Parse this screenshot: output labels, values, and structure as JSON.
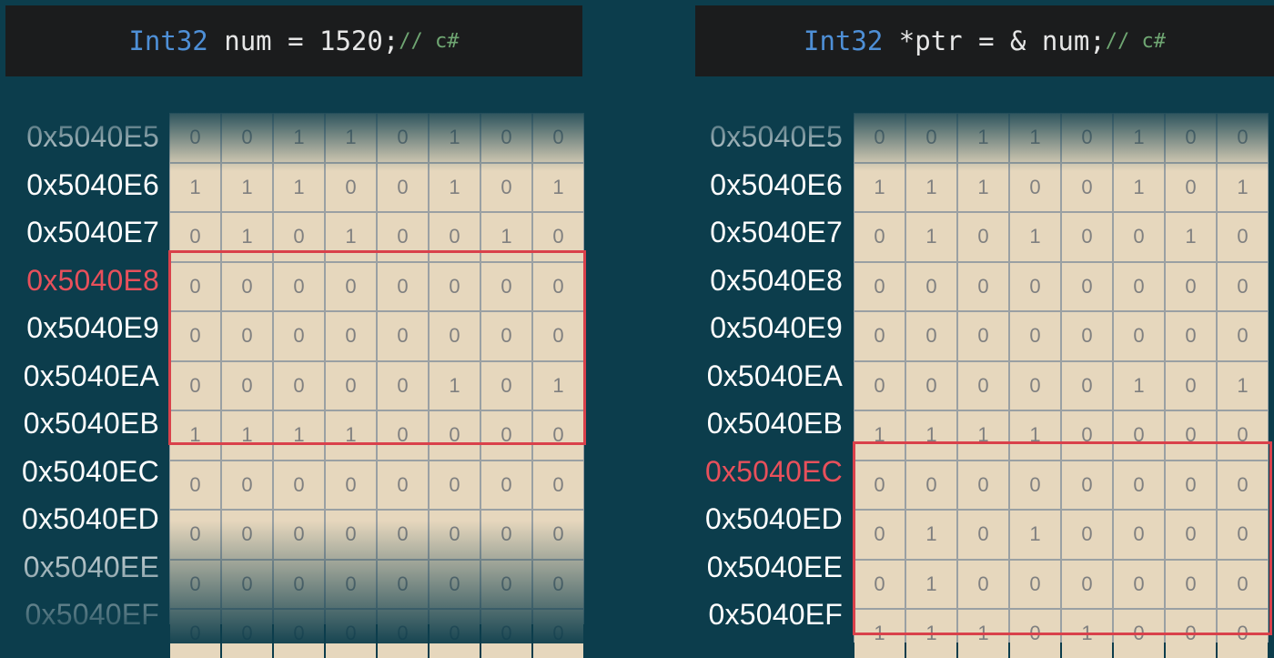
{
  "left": {
    "code": {
      "type": "Int32",
      "rest": " num = 1520;",
      "comment": "// c#"
    },
    "addresses": [
      "0x5040E5",
      "0x5040E6",
      "0x5040E7",
      "0x5040E8",
      "0x5040E9",
      "0x5040EA",
      "0x5040EB",
      "0x5040EC",
      "0x5040ED",
      "0x5040EE",
      "0x5040EF"
    ],
    "highlight_address": "0x5040E8",
    "rows": [
      [
        "0",
        "0",
        "1",
        "1",
        "0",
        "1",
        "0",
        "0"
      ],
      [
        "1",
        "1",
        "1",
        "0",
        "0",
        "1",
        "0",
        "1"
      ],
      [
        "0",
        "1",
        "0",
        "1",
        "0",
        "0",
        "1",
        "0"
      ],
      [
        "0",
        "0",
        "0",
        "0",
        "0",
        "0",
        "0",
        "0"
      ],
      [
        "0",
        "0",
        "0",
        "0",
        "0",
        "0",
        "0",
        "0"
      ],
      [
        "0",
        "0",
        "0",
        "0",
        "0",
        "1",
        "0",
        "1"
      ],
      [
        "1",
        "1",
        "1",
        "1",
        "0",
        "0",
        "0",
        "0"
      ],
      [
        "0",
        "0",
        "0",
        "0",
        "0",
        "0",
        "0",
        "0"
      ],
      [
        "0",
        "0",
        "0",
        "0",
        "0",
        "0",
        "0",
        "0"
      ],
      [
        "0",
        "0",
        "0",
        "0",
        "0",
        "0",
        "0",
        "0"
      ],
      [
        "0",
        "0",
        "0",
        "0",
        "0",
        "0",
        "0",
        "0"
      ]
    ]
  },
  "right": {
    "code": {
      "type": "Int32",
      "rest": " *ptr = & num;",
      "comment": "// c#"
    },
    "addresses": [
      "0x5040E5",
      "0x5040E6",
      "0x5040E7",
      "0x5040E8",
      "0x5040E9",
      "0x5040EA",
      "0x5040EB",
      "0x5040EC",
      "0x5040ED",
      "0x5040EE",
      "0x5040EF"
    ],
    "highlight_address": "0x5040EC",
    "rows": [
      [
        "0",
        "0",
        "1",
        "1",
        "0",
        "1",
        "0",
        "0"
      ],
      [
        "1",
        "1",
        "1",
        "0",
        "0",
        "1",
        "0",
        "1"
      ],
      [
        "0",
        "1",
        "0",
        "1",
        "0",
        "0",
        "1",
        "0"
      ],
      [
        "0",
        "0",
        "0",
        "0",
        "0",
        "0",
        "0",
        "0"
      ],
      [
        "0",
        "0",
        "0",
        "0",
        "0",
        "0",
        "0",
        "0"
      ],
      [
        "0",
        "0",
        "0",
        "0",
        "0",
        "1",
        "0",
        "1"
      ],
      [
        "1",
        "1",
        "1",
        "1",
        "0",
        "0",
        "0",
        "0"
      ],
      [
        "0",
        "0",
        "0",
        "0",
        "0",
        "0",
        "0",
        "0"
      ],
      [
        "0",
        "1",
        "0",
        "1",
        "0",
        "0",
        "0",
        "0"
      ],
      [
        "0",
        "1",
        "0",
        "0",
        "0",
        "0",
        "0",
        "0"
      ],
      [
        "1",
        "1",
        "1",
        "0",
        "1",
        "0",
        "0",
        "0"
      ]
    ]
  },
  "colors": {
    "background": "#0c3d4c",
    "cell": "#e6d7bd",
    "highlight": "#d9414b",
    "keyword": "#4e8fd6",
    "comment": "#6fa672"
  }
}
